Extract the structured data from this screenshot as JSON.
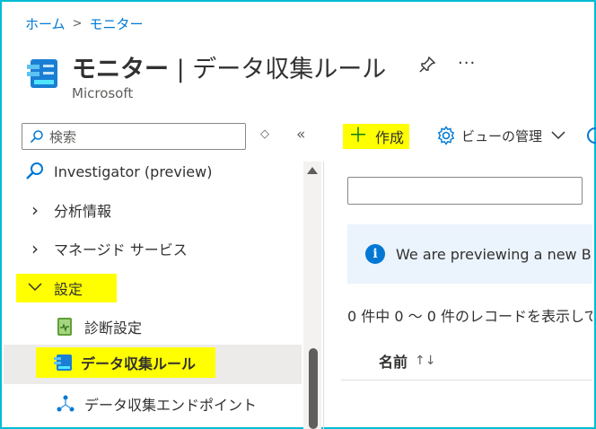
{
  "breadcrumb": {
    "home": "ホーム",
    "separator": ">",
    "current": "モニター"
  },
  "header": {
    "title_bold": "モニター",
    "title_sep": " | ",
    "title_rest": "データ収集ルール",
    "subtitle": "Microsoft",
    "more": "···"
  },
  "sidebar": {
    "search_placeholder": "検索",
    "sort_toggle": "◇",
    "collapse": "«",
    "items": [
      {
        "label": "Investigator (preview)",
        "icon": "magnifier-icon"
      },
      {
        "label": "分析情報",
        "chevron": "›"
      },
      {
        "label": "マネージド サービス",
        "chevron": "›"
      },
      {
        "label": "設定",
        "chevron": "⌄",
        "highlighted": true
      },
      {
        "label": "診断設定",
        "icon": "diagnostic-settings-icon"
      },
      {
        "label": "データ収集ルール",
        "icon": "data-collection-rules-icon",
        "selected": true,
        "highlighted": true
      },
      {
        "label": "データ収集エンドポイント",
        "icon": "endpoint-icon"
      }
    ]
  },
  "toolbar": {
    "create_plus": "＋",
    "create_label": "作成",
    "views_label": "ビューの管理",
    "views_chevron": "﹀"
  },
  "main": {
    "info_text": "We are previewing a new B",
    "info_icon": "i",
    "record_count": "0 件中 0 ～ 0 件のレコードを表示して",
    "column_name": "名前",
    "sort_icon": "↑↓"
  },
  "colors": {
    "accent": "#0078d4",
    "highlight": "#ffff00",
    "frame": "#00bcd4",
    "info_bg": "#ebf3fc"
  }
}
